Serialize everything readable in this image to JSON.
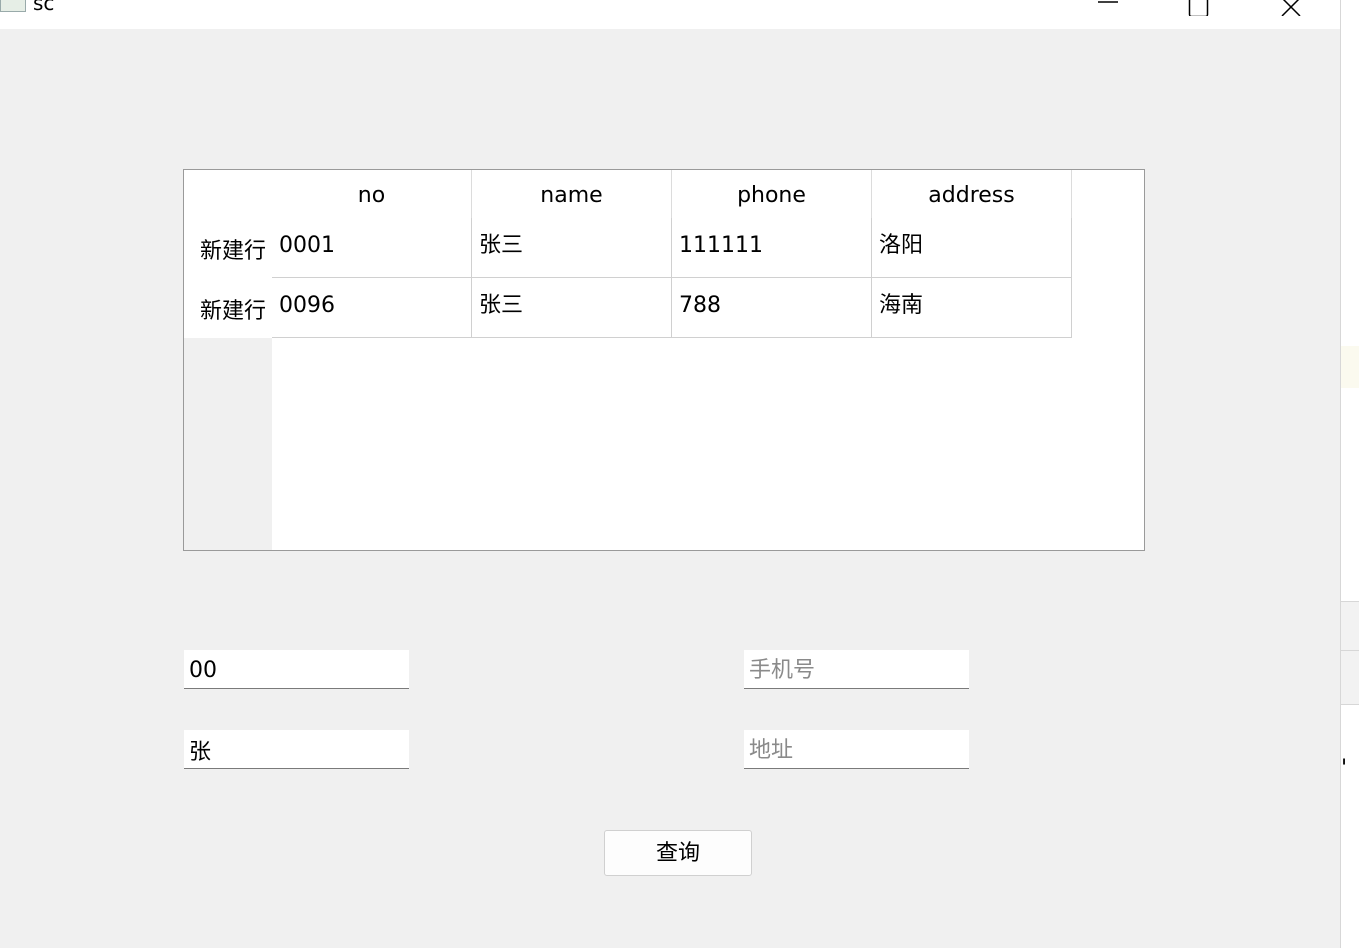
{
  "window": {
    "title": "sc"
  },
  "table": {
    "columns": [
      "no",
      "name",
      "phone",
      "address"
    ],
    "rows": [
      {
        "header": "新建行",
        "cells": [
          "0001",
          "张三",
          "111111",
          "洛阳"
        ]
      },
      {
        "header": "新建行",
        "cells": [
          "0096",
          "张三",
          "788",
          "海南"
        ]
      }
    ]
  },
  "form": {
    "no_value": "00",
    "name_value": "张",
    "phone_placeholder": "手机号",
    "address_placeholder": "地址",
    "query_label": "查询"
  },
  "background": {
    "right_edge_text": "'"
  }
}
